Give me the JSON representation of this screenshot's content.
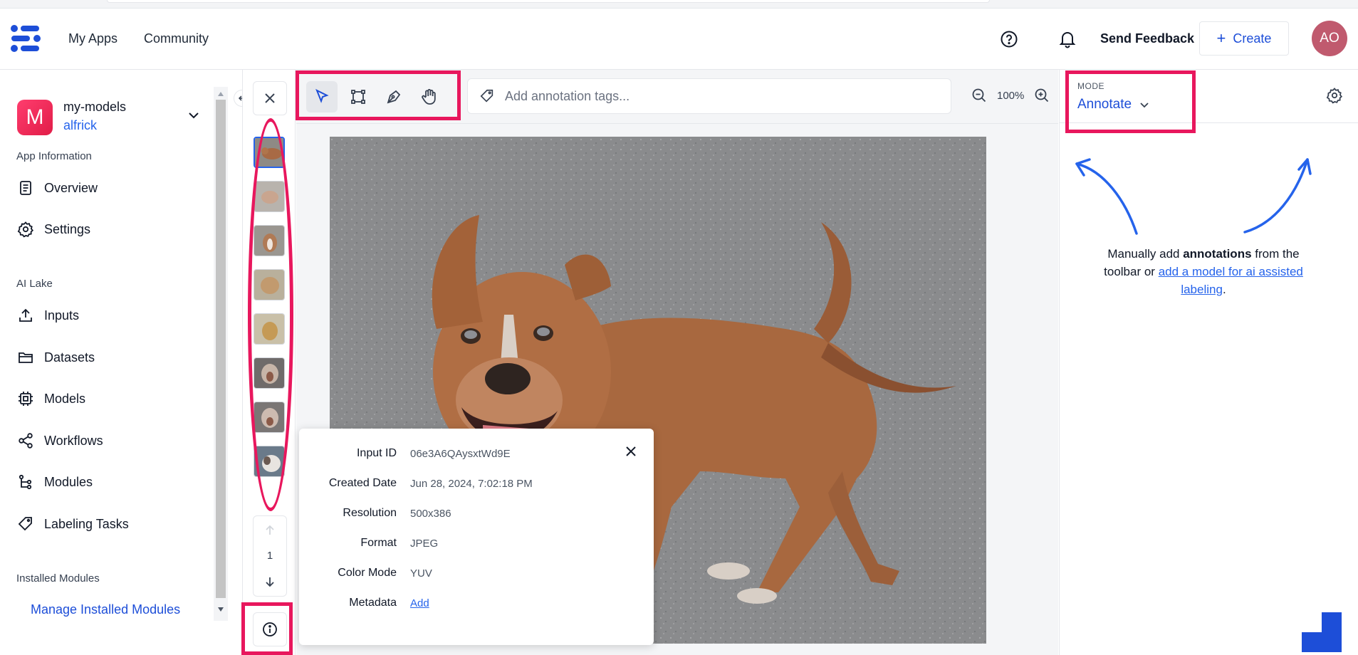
{
  "header": {
    "nav": [
      "My Apps",
      "Community"
    ],
    "send_feedback": "Send Feedback",
    "create_label": "Create",
    "avatar_initials": "AO"
  },
  "sidebar": {
    "app_initial": "M",
    "app_name": "my-models",
    "app_user": "alfrick",
    "section_app_info": "App Information",
    "app_info_items": [
      {
        "label": "Overview",
        "icon": "document-icon"
      },
      {
        "label": "Settings",
        "icon": "gear-icon"
      }
    ],
    "section_ai_lake": "AI Lake",
    "ai_lake_items": [
      {
        "label": "Inputs",
        "icon": "upload-icon"
      },
      {
        "label": "Datasets",
        "icon": "folder-icon"
      },
      {
        "label": "Models",
        "icon": "chip-icon"
      },
      {
        "label": "Workflows",
        "icon": "share-icon"
      },
      {
        "label": "Modules",
        "icon": "tree-icon"
      },
      {
        "label": "Labeling Tasks",
        "icon": "tag-icon"
      }
    ],
    "section_installed": "Installed Modules",
    "manage_modules": "Manage Installed Modules"
  },
  "thumbnails": {
    "count": 8,
    "selected_index": 0,
    "page": "1"
  },
  "toolbar": {
    "tools": [
      "select-tool",
      "bounding-box-tool",
      "polygon-tool",
      "pan-tool"
    ],
    "active_tool": "select-tool",
    "tag_placeholder": "Add annotation tags...",
    "zoom": "100%"
  },
  "input_info": {
    "rows": [
      {
        "label": "Input ID",
        "value": "06e3A6QAysxtWd9E"
      },
      {
        "label": "Created Date",
        "value": "Jun 28, 2024, 7:02:18 PM"
      },
      {
        "label": "Resolution",
        "value": "500x386"
      },
      {
        "label": "Format",
        "value": "JPEG"
      },
      {
        "label": "Color Mode",
        "value": "YUV"
      }
    ],
    "metadata_label": "Metadata",
    "metadata_action": "Add"
  },
  "right_panel": {
    "mode_label": "MODE",
    "mode_value": "Annotate",
    "hint_pre": "Manually add ",
    "hint_bold": "annotations",
    "hint_mid": " from the toolbar or ",
    "hint_link": "add a model for ai assisted labeling",
    "hint_end": "."
  },
  "colors": {
    "accent": "#2563eb",
    "highlight": "#e8175d",
    "avatar": "#c05a6e",
    "app_tile": "#e11d48"
  }
}
